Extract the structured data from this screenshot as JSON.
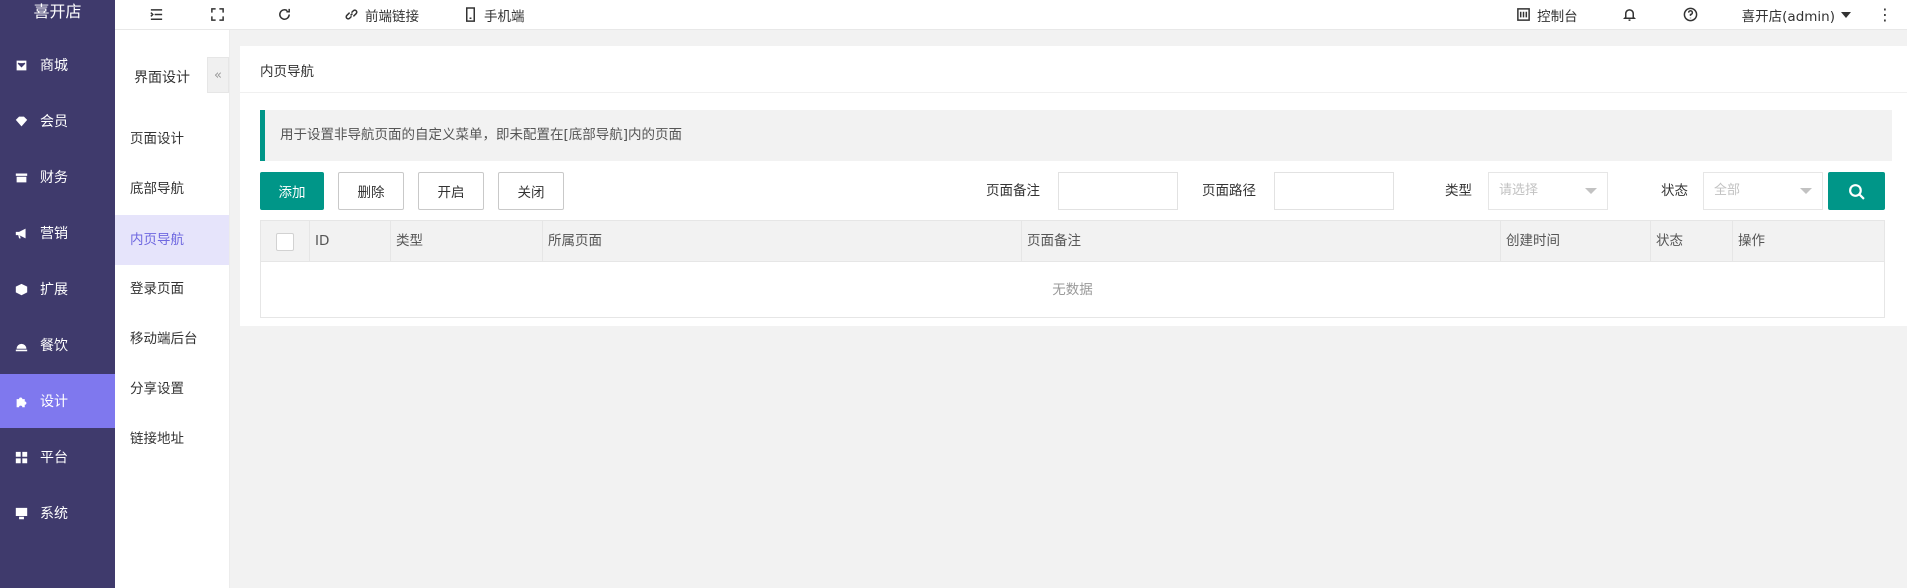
{
  "app": {
    "logo": "喜开店"
  },
  "sidebar": {
    "items": [
      {
        "label": "商城",
        "icon": "shop-icon"
      },
      {
        "label": "会员",
        "icon": "member-icon"
      },
      {
        "label": "财务",
        "icon": "finance-icon"
      },
      {
        "label": "营销",
        "icon": "megaphone-icon"
      },
      {
        "label": "扩展",
        "icon": "cube-icon"
      },
      {
        "label": "餐饮",
        "icon": "food-icon"
      },
      {
        "label": "设计",
        "icon": "puzzle-icon",
        "active": true
      },
      {
        "label": "平台",
        "icon": "grid-icon"
      },
      {
        "label": "系统",
        "icon": "system-icon"
      }
    ]
  },
  "topbar": {
    "frontend_link": "前端链接",
    "mobile": "手机端",
    "console": "控制台",
    "user": "喜开店(admin)"
  },
  "subsidebar": {
    "title": "界面设计",
    "collapse": "«",
    "items": [
      "页面设计",
      "底部导航",
      "内页导航",
      "登录页面",
      "移动端后台",
      "分享设置",
      "链接地址"
    ],
    "active_index": 2
  },
  "main": {
    "title": "内页导航",
    "tip": "用于设置非导航页面的自定义菜单，即未配置在[底部导航]内的页面",
    "buttons": {
      "add": "添加",
      "delete": "删除",
      "enable": "开启",
      "close": "关闭"
    },
    "filters": {
      "remark_label": "页面备注",
      "path_label": "页面路径",
      "type_label": "类型",
      "type_placeholder": "请选择",
      "status_label": "状态",
      "status_value": "全部"
    },
    "table": {
      "columns": [
        "ID",
        "类型",
        "所属页面",
        "页面备注",
        "创建时间",
        "状态",
        "操作"
      ],
      "empty": "无数据"
    }
  },
  "colors": {
    "sidebar_bg": "#3f3a6c",
    "sidebar_active": "#7f78ee",
    "primary": "#009688",
    "sub_active_bg": "#e6e4fb"
  }
}
